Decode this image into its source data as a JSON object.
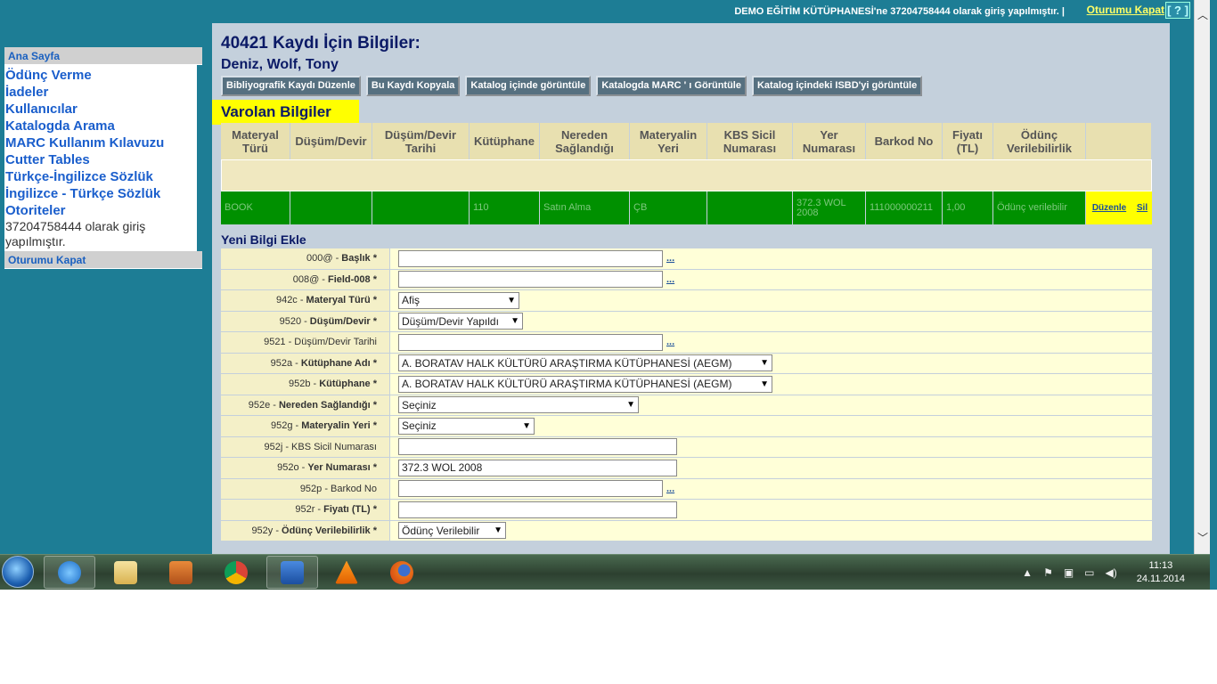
{
  "topbar": {
    "login_info": "DEMO EĞİTİM KÜTÜPHANESİ'ne 37204758444 olarak giriş yapılmıştır. |",
    "logout": "Oturumu Kapat",
    "separator": "|",
    "help": "[ ? ]"
  },
  "sidebar": {
    "header": "Ana Sayfa",
    "links": [
      "Ödünç Verme",
      "İadeler",
      "Kullanıcılar",
      "Katalogda Arama",
      "MARC Kullanım Kılavuzu",
      "Cutter Tables",
      "Türkçe-İngilizce Sözlük",
      "İngilizce - Türkçe Sözlük",
      "Otoriteler"
    ],
    "login_text": "37204758444 olarak giriş yapılmıştır.",
    "logout_header": "Oturumu Kapat"
  },
  "record": {
    "title": "40421 Kaydı İçin Bilgiler:",
    "authors": "Deniz, Wolf, Tony"
  },
  "toolbar": {
    "buttons": [
      "Bibliyografik Kaydı Düzenle",
      "Bu Kaydı Kopyala",
      "Katalog içinde görüntüle",
      "Katalogda MARC ' ı Görüntüle",
      "Katalog içindeki ISBD'yi görüntüle"
    ]
  },
  "existing": {
    "heading": "Varolan Bilgiler",
    "columns": [
      "Materyal Türü",
      "Düşüm/Devir",
      "Düşüm/Devir Tarihi",
      "Kütüphane",
      "Nereden Sağlandığı",
      "Materyalin Yeri",
      "KBS Sicil Numarası",
      "Yer Numarası",
      "Barkod No",
      "Fiyatı (TL)",
      "Ödünç Verilebilirlik",
      ""
    ],
    "row": [
      "BOOK",
      "",
      "",
      "110",
      "Satın Alma",
      "ÇB",
      "",
      "372.3 WOL 2008",
      "111000000211",
      "1,00",
      "Ödünç verilebilir"
    ],
    "edit": "Düzenle",
    "delete": "Sil"
  },
  "new_form": {
    "heading": "Yeni Bilgi Ekle",
    "dots": "...",
    "fields": [
      {
        "code": "000@ -",
        "label": "Başlık *",
        "bold": true,
        "type": "text",
        "value": "",
        "dots": true
      },
      {
        "code": "008@ -",
        "label": "Field-008 *",
        "bold": true,
        "type": "text",
        "value": "",
        "dots": true
      },
      {
        "code": "942c -",
        "label": "Materyal Türü *",
        "bold": true,
        "type": "select",
        "value": "Afiş"
      },
      {
        "code": "9520 -",
        "label": "Düşüm/Devir *",
        "bold": true,
        "type": "select",
        "value": "Düşüm/Devir Yapıldı"
      },
      {
        "code": "9521 -",
        "label": "Düşüm/Devir Tarihi",
        "bold": false,
        "type": "text",
        "value": "",
        "dots": true
      },
      {
        "code": "952a -",
        "label": "Kütüphane Adı *",
        "bold": true,
        "type": "select",
        "value": "A. BORATAV HALK KÜLTÜRÜ ARAŞTIRMA KÜTÜPHANESİ (AEGM)"
      },
      {
        "code": "952b -",
        "label": "Kütüphane *",
        "bold": true,
        "type": "select",
        "value": "A. BORATAV HALK KÜLTÜRÜ ARAŞTIRMA KÜTÜPHANESİ (AEGM)"
      },
      {
        "code": "952e -",
        "label": "Nereden Sağlandığı *",
        "bold": true,
        "type": "select",
        "value": "Seçiniz"
      },
      {
        "code": "952g -",
        "label": "Materyalin Yeri *",
        "bold": true,
        "type": "select",
        "value": "Seçiniz"
      },
      {
        "code": "952j -",
        "label": "KBS Sicil Numarası",
        "bold": false,
        "type": "text",
        "value": ""
      },
      {
        "code": "952o -",
        "label": "Yer Numarası *",
        "bold": true,
        "type": "text",
        "value": "372.3 WOL 2008"
      },
      {
        "code": "952p -",
        "label": "Barkod No",
        "bold": false,
        "type": "text",
        "value": "",
        "dots": true
      },
      {
        "code": "952r -",
        "label": "Fiyatı (TL) *",
        "bold": true,
        "type": "text",
        "value": ""
      },
      {
        "code": "952y -",
        "label": "Ödünç Verilebilirlik *",
        "bold": true,
        "type": "select",
        "value": "Ödünç Verilebilir"
      }
    ]
  },
  "taskbar": {
    "apps": [
      "internet-explorer",
      "file-explorer",
      "media-player",
      "chrome",
      "word",
      "vlc",
      "firefox"
    ],
    "time": "11:13",
    "date": "24.11.2014"
  }
}
